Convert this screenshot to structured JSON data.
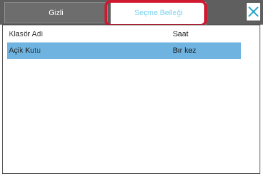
{
  "tabs": [
    {
      "label": "Gizli",
      "active": false
    },
    {
      "label": "Seçme Belleği",
      "active": true
    }
  ],
  "table": {
    "columns": [
      "Klasör Adi",
      "Saat"
    ],
    "rows": [
      {
        "name": "Açik Kutu",
        "time": "Bır kez",
        "selected": true
      }
    ]
  },
  "colors": {
    "top_bar": "#5f5f5f",
    "active_tab_text": "#7ad3ee",
    "highlight": "#d0192f",
    "selected_row": "#6fb3e0",
    "close_icon": "#2aa6c8"
  },
  "icons": {
    "close": "close-icon"
  }
}
